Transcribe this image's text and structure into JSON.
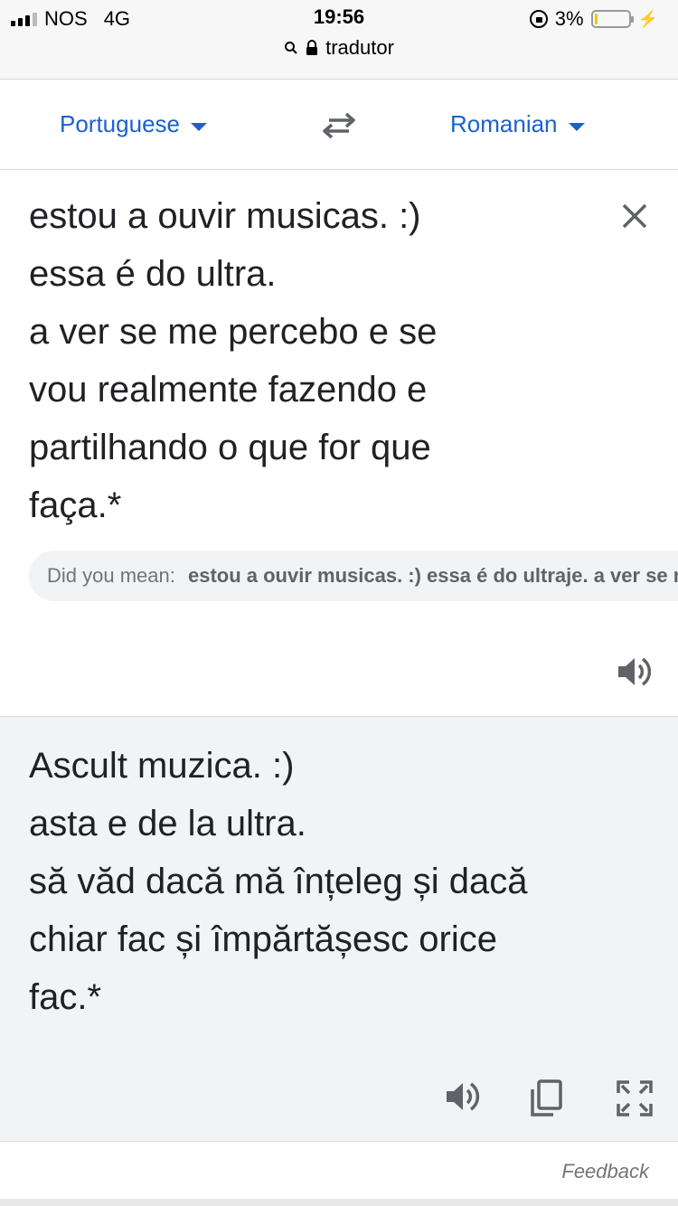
{
  "status_bar": {
    "carrier": "NOS",
    "network": "4G",
    "time": "19:56",
    "battery_percent": "3%",
    "battery_level": 0.08
  },
  "url_bar": {
    "domain": "tradutor"
  },
  "languages": {
    "source": "Portuguese",
    "target": "Romanian"
  },
  "source": {
    "text": "estou a ouvir musicas. :)\nessa é do ultra.\na ver se me percebo e se\nvou realmente fazendo e\npartilhando o que for que\nfaça.*",
    "did_you_mean_label": "Did you mean:",
    "did_you_mean_suggestion": "estou a ouvir musicas. :) essa é do ultraje. a ver se me percebo"
  },
  "target": {
    "text": "Ascult muzica. :)\nasta e de la ultra.\nsă văd dacă mă înțeleg și dacă\nchiar fac și împărtășesc orice\nfac.*"
  },
  "footer": {
    "feedback": "Feedback"
  },
  "icons": {
    "swap": "swap-arrows-icon",
    "clear": "close-icon",
    "speak": "speaker-icon",
    "copy": "copy-icon",
    "fullscreen": "fullscreen-icon"
  },
  "colors": {
    "accent": "#1a62cc",
    "target_background": "#f1f3f4"
  }
}
